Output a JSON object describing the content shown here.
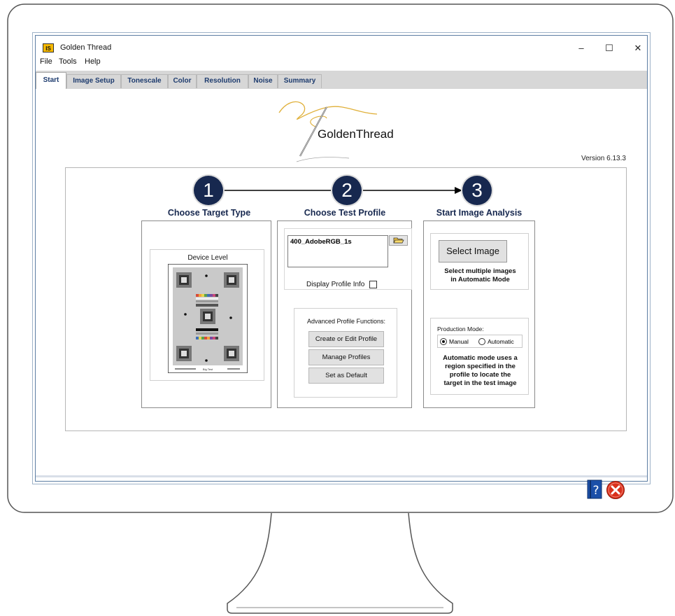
{
  "window": {
    "app_logo_text": "IS",
    "title": "Golden Thread",
    "minimize_glyph": "–",
    "maximize_glyph": "☐",
    "close_glyph": "✕"
  },
  "menu": {
    "items": [
      "File",
      "Tools",
      "Help"
    ]
  },
  "tabs": [
    "Start",
    "Image Setup",
    "Tonescale",
    "Color",
    "Resolution",
    "Noise",
    "Summary"
  ],
  "active_tab": "Start",
  "branding": {
    "logo_text": "GoldenThread",
    "version": "Version 6.13.3"
  },
  "steps": [
    {
      "number": "1",
      "title": "Choose Target Type"
    },
    {
      "number": "2",
      "title": "Choose Test Profile"
    },
    {
      "number": "3",
      "title": "Start Image Analysis"
    }
  ],
  "target": {
    "label": "Device Level",
    "footer_small_text": "Big Test"
  },
  "profile": {
    "selected": "400_AdobeRGB_1s",
    "display_info_label": "Display Profile Info",
    "display_info_checked": false,
    "advanced_title": "Advanced Profile Functions:",
    "buttons": [
      "Create or Edit Profile",
      "Manage Profiles",
      "Set as Default"
    ]
  },
  "analysis": {
    "select_button": "Select Image",
    "select_hint_line1": "Select multiple images",
    "select_hint_line2": "in Automatic Mode",
    "production_mode_label": "Production Mode:",
    "mode_manual": "Manual",
    "mode_automatic": "Automatic",
    "selected_mode": "Manual",
    "auto_note_lines": [
      "Automatic mode uses a",
      "region specified in the",
      "profile to locate the",
      "target in the test image"
    ]
  },
  "icons": {
    "help": "help-book-icon",
    "exit": "exit-x-icon",
    "folder": "folder-open-icon"
  },
  "colors": {
    "step_circle": "#17284f",
    "accent_gold": "#e0b03a",
    "tab_text": "#1d3b6e",
    "exit_red": "#d9301c"
  }
}
